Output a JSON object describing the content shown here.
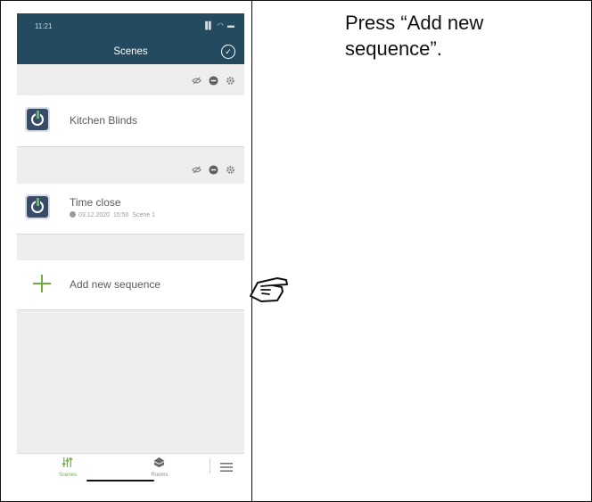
{
  "phone": {
    "status": {
      "time": "11:21",
      "signal": "▐▌ ◠ ▬"
    },
    "header": {
      "title": "Scenes",
      "done_glyph": "✓"
    },
    "groups": [
      {
        "scene": {
          "name": "Kitchen Blinds"
        }
      },
      {
        "scene": {
          "name": "Time close",
          "date": "03.12.2020",
          "time": "15:50",
          "scene_label": "Scene 1"
        }
      }
    ],
    "add_sequence_label": "Add new sequence",
    "tabs": [
      {
        "label": "Scenes",
        "active": true
      },
      {
        "label": "Rooms",
        "active": false
      }
    ]
  },
  "instruction": "Press “Add new sequence”.",
  "colors": {
    "header": "#234a5f",
    "accent": "#6fae3f",
    "background": "#eeeeee"
  },
  "icons": [
    "hidden-eye-icon",
    "minus-circle-icon",
    "gear-icon",
    "power-icon",
    "clock-icon",
    "plus-icon",
    "sliders-icon",
    "house-icon",
    "hamburger-menu-icon",
    "pointing-hand-icon"
  ]
}
